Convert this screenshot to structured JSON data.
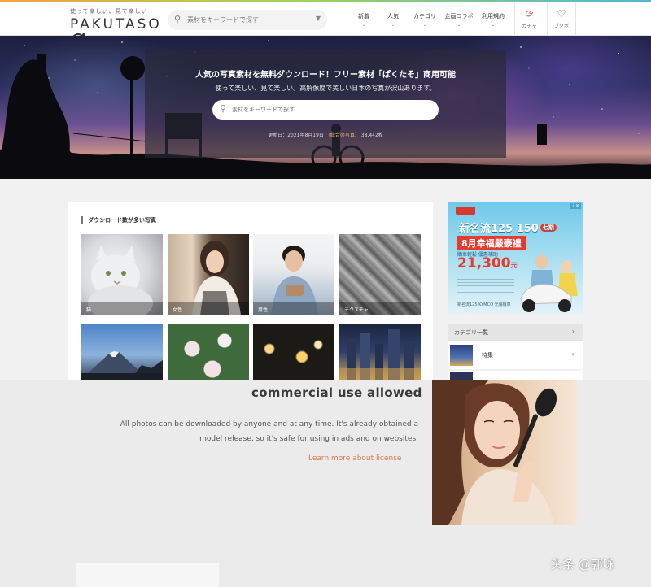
{
  "header": {
    "logo_tagline": "使って楽しい、見て楽しい",
    "logo_text": "PAKUTASO",
    "search_placeholder": "素材をキーワードで探す",
    "nav": [
      {
        "label": "新着"
      },
      {
        "label": "人気"
      },
      {
        "label": "カテゴリ"
      },
      {
        "label": "企画コラボ"
      },
      {
        "label": "利用規約"
      }
    ],
    "gacha_label": "ガチャ",
    "favorites_label": "ブクボ"
  },
  "hero": {
    "title": "人気の写真素材を無料ダウンロード！フリー素材「ぱくたそ」商用可能",
    "subtitle": "使って楽しい、見て楽しい。高解像度で美しい日本の写真が沢山あります。",
    "search_placeholder": "素材をキーワードで探す",
    "updated_prefix": "更新日：2021年8月19日",
    "updated_highlight": "（総合の写真）",
    "updated_count": "38,442枚"
  },
  "popular": {
    "title": "ダウンロード数が多い写真",
    "items": [
      {
        "label": "猫"
      },
      {
        "label": "女性"
      },
      {
        "label": "男性"
      },
      {
        "label": "テクスチャ"
      },
      {
        "label": ""
      },
      {
        "label": ""
      },
      {
        "label": ""
      },
      {
        "label": ""
      }
    ]
  },
  "ad": {
    "badge": "i ✕",
    "title": "新名流125 150",
    "title_tag": "七期",
    "month": "8月幸福嚴豪禮",
    "sub": "購車輕鬆 優惠補助",
    "price": "21,300",
    "price_unit": "元",
    "footer": "新名流125 KYMCO 光陽機車"
  },
  "sidebar": {
    "category_header": "カテゴリ一覧",
    "category_items": [
      {
        "label": "特集"
      }
    ]
  },
  "commercial": {
    "title": "commercial use allowed",
    "body": "All photos can be downloaded by anyone and at any time. It's already obtained a model release, so it's safe for using in ads and on websites.",
    "link": "Learn more about license"
  },
  "watermark": "头条 @郭咏",
  "colors": {
    "accent_orange": "#d8784d",
    "gacha_red": "#e95a4d",
    "updated_highlight": "#f2b56a"
  },
  "icons": {
    "search": "search-icon",
    "gacha": "refresh-icon",
    "favorites": "heart-icon",
    "chevron": "chevron-right-icon"
  }
}
